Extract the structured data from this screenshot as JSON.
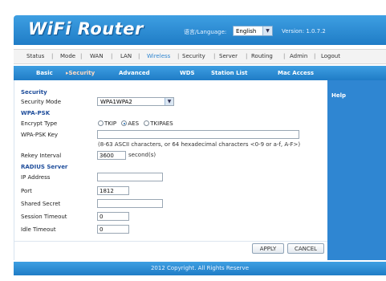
{
  "header": {
    "logo": "WiFi Router",
    "language_label": "语言/Language:",
    "language_value": "English",
    "version": "Version: 1.0.7.2"
  },
  "menu": [
    "Status",
    "Mode",
    "WAN",
    "LAN",
    "Wireless",
    "Security",
    "Server",
    "Routing",
    "Admin",
    "Logout"
  ],
  "menu_active": "Wireless",
  "subnav": {
    "basic": "Basic",
    "security": "Security",
    "advanced": "Advanced",
    "wds": "WDS",
    "station_list": "Station List",
    "mac_access": "Mac Access"
  },
  "form": {
    "security_section": "Security",
    "security_mode_label": "Security Mode",
    "security_mode_value": "WPA1WPA2",
    "wpa_section": "WPA-PSK",
    "encrypt_type_label": "Encrypt Type",
    "encrypt_options": [
      "TKIP",
      "AES",
      "TKIPAES"
    ],
    "encrypt_selected": "AES",
    "wpa_key_label": "WPA-PSK Key",
    "wpa_key_value": "",
    "wpa_key_hint": "(8-63 ASCII characters, or 64 hexadecimal characters <0-9 or a-f, A-F>)",
    "rekey_label": "Rekey Interval",
    "rekey_value": "3600",
    "rekey_unit": "second(s)",
    "radius_section": "RADIUS Server",
    "ip_label": "IP Address",
    "ip_value": "",
    "port_label": "Port",
    "port_value": "1812",
    "secret_label": "Shared Secret",
    "secret_value": "",
    "session_label": "Session Timeout",
    "session_value": "0",
    "idle_label": "Idle Timeout",
    "idle_value": "0"
  },
  "buttons": {
    "apply": "APPLY",
    "cancel": "CANCEL"
  },
  "help": {
    "title": "Help"
  },
  "footer": {
    "text": "2012 Copyright. All Rights Reserve"
  }
}
